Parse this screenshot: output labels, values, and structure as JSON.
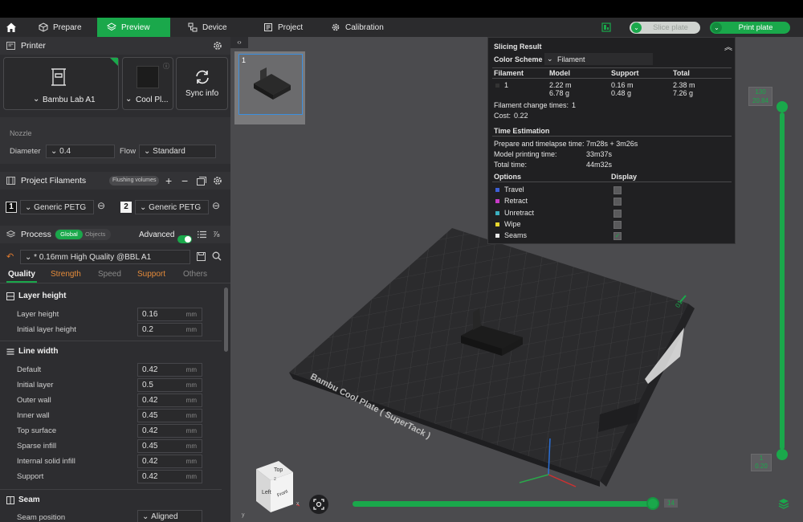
{
  "colors": {
    "accent": "#1aa84b",
    "panel": "#2d2d30",
    "viewport": "#4b4b4e"
  },
  "tabs": [
    {
      "label": "Prepare",
      "icon": "cube-icon"
    },
    {
      "label": "Preview",
      "icon": "layers-icon"
    },
    {
      "label": "Device",
      "icon": "device-icon"
    },
    {
      "label": "Project",
      "icon": "document-icon"
    },
    {
      "label": "Calibration",
      "icon": "gear-icon"
    }
  ],
  "toolbar": {
    "slice_label": "Slice plate",
    "print_label": "Print plate"
  },
  "printer": {
    "title": "Printer",
    "name": "Bambu Lab A1",
    "plate": "Cool Pl...",
    "sync": "Sync info",
    "nozzle_label": "Nozzle",
    "diameter_label": "Diameter",
    "diameter_value": "0.4",
    "flow_label": "Flow",
    "flow_value": "Standard"
  },
  "filaments": {
    "title": "Project Filaments",
    "flushing": "Flushing volumes",
    "items": [
      {
        "index": "1",
        "name": "Generic PETG"
      },
      {
        "index": "2",
        "name": "Generic PETG"
      }
    ]
  },
  "process": {
    "title": "Process",
    "global": "Global",
    "objects": "Objects",
    "advanced": "Advanced",
    "preset": "* 0.16mm High Quality @BBL A1",
    "tabs": [
      "Quality",
      "Strength",
      "Speed",
      "Support",
      "Others"
    ]
  },
  "settings": {
    "layer_height_group": "Layer height",
    "layer_height": [
      {
        "label": "Layer height",
        "value": "0.16",
        "unit": "mm"
      },
      {
        "label": "Initial layer height",
        "value": "0.2",
        "unit": "mm"
      }
    ],
    "line_width_group": "Line width",
    "line_width": [
      {
        "label": "Default",
        "value": "0.42",
        "unit": "mm"
      },
      {
        "label": "Initial layer",
        "value": "0.5",
        "unit": "mm"
      },
      {
        "label": "Outer wall",
        "value": "0.42",
        "unit": "mm"
      },
      {
        "label": "Inner wall",
        "value": "0.45",
        "unit": "mm"
      },
      {
        "label": "Top surface",
        "value": "0.42",
        "unit": "mm"
      },
      {
        "label": "Sparse infill",
        "value": "0.45",
        "unit": "mm"
      },
      {
        "label": "Internal solid infill",
        "value": "0.42",
        "unit": "mm"
      },
      {
        "label": "Support",
        "value": "0.42",
        "unit": "mm"
      }
    ],
    "seam_group": "Seam",
    "seam_position_label": "Seam position",
    "seam_position_value": "Aligned"
  },
  "thumbnail": {
    "index": "1"
  },
  "slicing": {
    "title": "Slicing Result",
    "color_scheme_label": "Color Scheme",
    "color_scheme_value": "Filament",
    "headers": [
      "Filament",
      "Model",
      "Support",
      "Total"
    ],
    "row": {
      "filament": "1",
      "model_len": "2.22 m",
      "model_weight": "6.78 g",
      "support_len": "0.16 m",
      "support_weight": "0.48 g",
      "total_len": "2.38 m",
      "total_weight": "7.26 g"
    },
    "change_times_label": "Filament change times:",
    "change_times_value": "1",
    "cost_label": "Cost:",
    "cost_value": "0.22",
    "time_title": "Time Estimation",
    "times": [
      {
        "label": "Prepare and timelapse time:",
        "value": "7m28s + 3m26s"
      },
      {
        "label": "Model printing time:",
        "value": "33m37s"
      },
      {
        "label": "Total time:",
        "value": "44m32s"
      }
    ],
    "options_label": "Options",
    "display_label": "Display",
    "options": [
      {
        "label": "Travel",
        "color": "#3d5fd6",
        "checked": false
      },
      {
        "label": "Retract",
        "color": "#c83ac8",
        "checked": false
      },
      {
        "label": "Unretract",
        "color": "#3bb0c0",
        "checked": false
      },
      {
        "label": "Wipe",
        "color": "#e6d52e",
        "checked": false
      },
      {
        "label": "Seams",
        "color": "#e8e8e8",
        "checked": true
      }
    ]
  },
  "layer_slider": {
    "top_layer": "130",
    "top_height": "20.84",
    "bottom_layer": "1",
    "bottom_height": "0.20"
  },
  "horizontal_slider": {
    "value": "14"
  },
  "plate": {
    "brand_text": "Bambu Cool Plate ( SuperTack )",
    "corner_number": "01"
  },
  "view_cube": {
    "front": "Front",
    "left": "Left",
    "top": "Top",
    "axis_x": "x",
    "axis_y": "y",
    "axis_z": "z"
  }
}
